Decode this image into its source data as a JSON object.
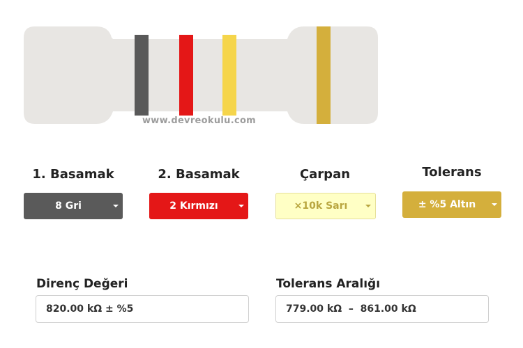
{
  "watermark": "www.devreokulu.com",
  "resistor": {
    "body_color": "#e8e6e3",
    "bands": [
      {
        "name": "band-1",
        "color": "#595959"
      },
      {
        "name": "band-2",
        "color": "#e41717"
      },
      {
        "name": "band-3",
        "color": "#f5d54b"
      },
      {
        "name": "band-4",
        "color": "#d4af3c"
      }
    ]
  },
  "selectors": [
    {
      "label": "1. Basamak",
      "value": "8 Gri",
      "bg": "#5a5a5a",
      "fg": "#ffffff"
    },
    {
      "label": "2. Basamak",
      "value": "2 Kırmızı",
      "bg": "#e41717",
      "fg": "#ffffff"
    },
    {
      "label": "Çarpan",
      "value": "×10k Sarı",
      "bg": "#ffffc5",
      "fg": "#b9a640"
    },
    {
      "label": "Tolerans",
      "value": "± %5 Altın",
      "bg": "#d4af3c",
      "fg": "#ffffff"
    }
  ],
  "resistance": {
    "label": "Direnç Değeri",
    "value": "820.00 kΩ ± %5"
  },
  "tolerance_range": {
    "label": "Tolerans Aralığı",
    "value": "779.00 kΩ  –  861.00 kΩ"
  }
}
